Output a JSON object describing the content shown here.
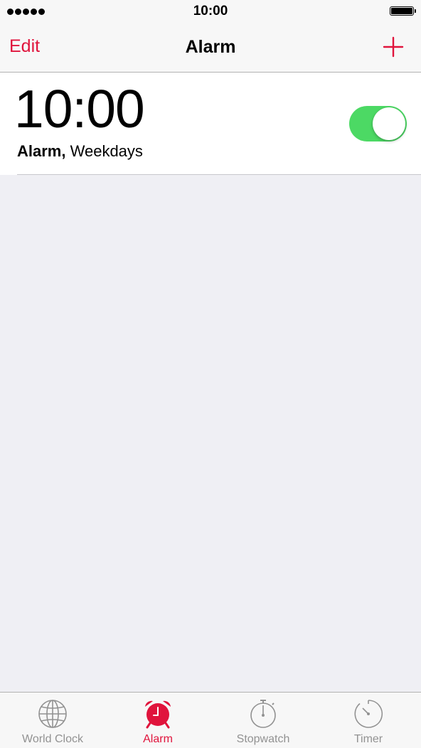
{
  "status_bar": {
    "time": "10:00",
    "signal_dots": 5,
    "battery_level": 1.0
  },
  "nav": {
    "edit_label": "Edit",
    "title": "Alarm",
    "add_icon": "plus-icon"
  },
  "alarms": [
    {
      "time": "10:00",
      "label": "Alarm,",
      "repeat": "Weekdays",
      "enabled": true
    }
  ],
  "tabs": [
    {
      "label": "World Clock",
      "icon": "globe-icon",
      "active": false
    },
    {
      "label": "Alarm",
      "icon": "alarm-clock-icon",
      "active": true
    },
    {
      "label": "Stopwatch",
      "icon": "stopwatch-icon",
      "active": false
    },
    {
      "label": "Timer",
      "icon": "timer-icon",
      "active": false
    }
  ],
  "colors": {
    "accent": "#e0143c",
    "toggle_on": "#4cd964",
    "inactive_tab": "#929292",
    "background": "#efeff4"
  }
}
